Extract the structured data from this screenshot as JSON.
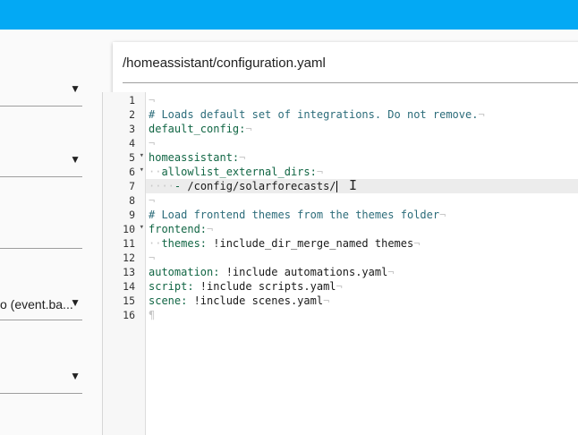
{
  "left_panel": {
    "dropdowns": [
      {
        "label": "",
        "arrow": "▼"
      },
      {
        "label": "",
        "arrow": "▼"
      },
      {
        "label": "",
        "arrow": ""
      },
      {
        "label": "o (event.ba...",
        "arrow": "▼"
      },
      {
        "label": "",
        "arrow": "▼"
      }
    ]
  },
  "editor": {
    "file_path": "/homeassistant/configuration.yaml",
    "lines": [
      {
        "num": "1",
        "fold": ""
      },
      {
        "num": "2",
        "fold": ""
      },
      {
        "num": "3",
        "fold": ""
      },
      {
        "num": "4",
        "fold": ""
      },
      {
        "num": "5",
        "fold": "▾"
      },
      {
        "num": "6",
        "fold": "▾"
      },
      {
        "num": "7",
        "fold": ""
      },
      {
        "num": "8",
        "fold": ""
      },
      {
        "num": "9",
        "fold": ""
      },
      {
        "num": "10",
        "fold": "▾"
      },
      {
        "num": "11",
        "fold": ""
      },
      {
        "num": "12",
        "fold": ""
      },
      {
        "num": "13",
        "fold": ""
      },
      {
        "num": "14",
        "fold": ""
      },
      {
        "num": "15",
        "fold": ""
      },
      {
        "num": "16",
        "fold": ""
      }
    ],
    "code": {
      "l1_eol": "¬",
      "l2_comment": "# Loads default set of integrations. Do not remove.",
      "l2_eol": "¬",
      "l3_key": "default_config:",
      "l3_eol": "¬",
      "l4_eol": "¬",
      "l5_key": "homeassistant:",
      "l5_eol": "¬",
      "l6_indent": "··",
      "l6_key": "allowlist_external_dirs:",
      "l6_eol": "¬",
      "l7_indent": "····",
      "l7_dash": "-",
      "l7_value": " /config/solarforecasts/",
      "l8_eol": "¬",
      "l9_comment": "# Load frontend themes from the themes folder",
      "l9_eol": "¬",
      "l10_key": "frontend:",
      "l10_eol": "¬",
      "l11_indent": "··",
      "l11_key": "themes:",
      "l11_value": " !include_dir_merge_named themes",
      "l11_eol": "¬",
      "l12_eol": "¬",
      "l13_key": "automation:",
      "l13_value": " !include automations.yaml",
      "l13_eol": "¬",
      "l14_key": "script:",
      "l14_value": " !include scripts.yaml",
      "l14_eol": "¬",
      "l15_key": "scene:",
      "l15_value": " !include scenes.yaml",
      "l15_eol": "¬",
      "l16_eof": "¶"
    },
    "cursor_icon": "I"
  }
}
